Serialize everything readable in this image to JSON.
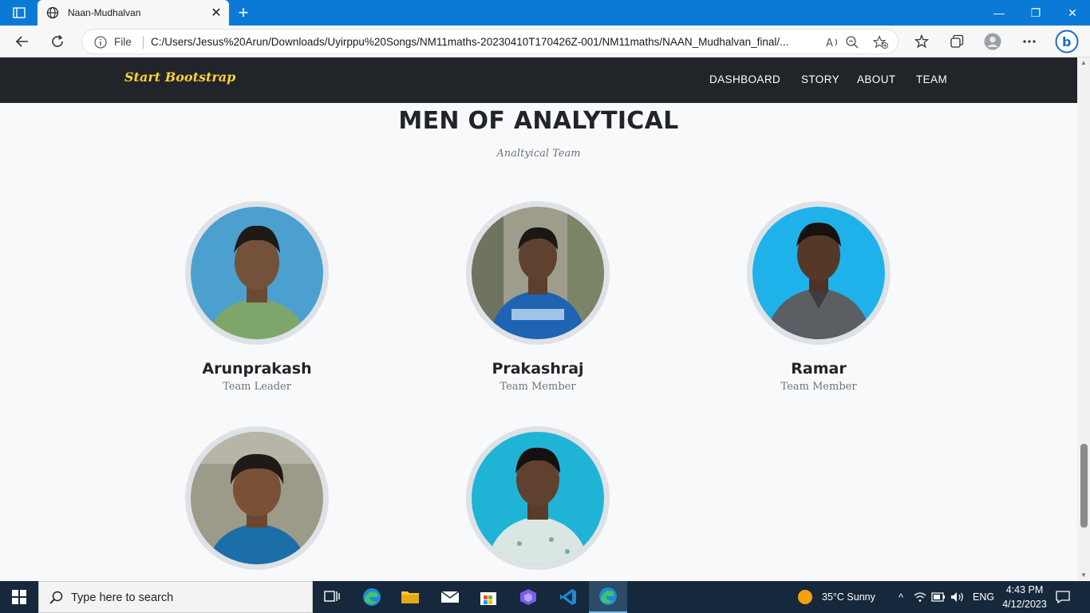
{
  "browser": {
    "tab_title": "Naan-Mudhalvan",
    "file_label": "File",
    "url": "C:/Users/Jesus%20Arun/Downloads/Uyirppu%20Songs/NM11maths-20230410T170426Z-001/NM11maths/NAAN_Mudhalvan_final/..."
  },
  "navbar": {
    "brand": "Start Bootstrap",
    "items": [
      {
        "label": "DASHBOARD"
      },
      {
        "label": "STORY"
      },
      {
        "label": "ABOUT"
      },
      {
        "label": "TEAM"
      }
    ]
  },
  "team": {
    "heading": "MEN OF ANALYTICAL",
    "subheading": "Analtyical Team",
    "members": [
      {
        "name": "Arunprakash",
        "role": "Team Leader"
      },
      {
        "name": "Prakashraj",
        "role": "Team Member"
      },
      {
        "name": "Ramar",
        "role": "Team Member"
      },
      {
        "name": "",
        "role": ""
      },
      {
        "name": "",
        "role": ""
      }
    ]
  },
  "taskbar": {
    "search_placeholder": "Type here to search",
    "weather": "35°C  Sunny",
    "language": "ENG",
    "time": "4:43 PM",
    "date": "4/12/2023"
  },
  "colors": {
    "titlebar": "#0a7ad6",
    "navbar": "#212529",
    "brand": "#fed136",
    "taskbar": "#16283b"
  }
}
